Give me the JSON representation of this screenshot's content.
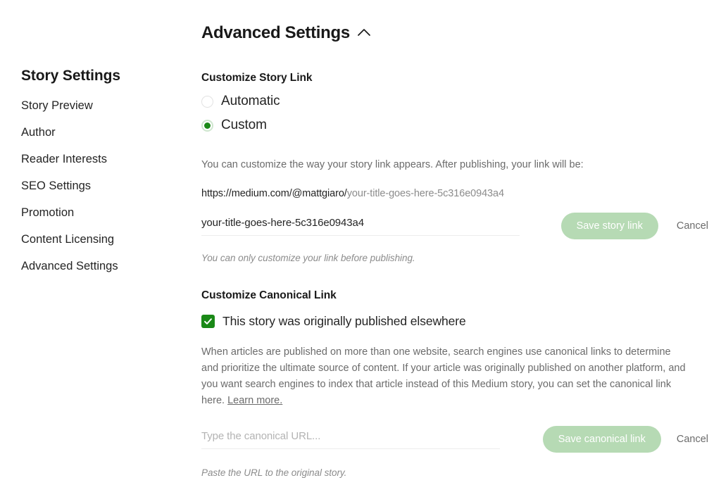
{
  "sidebar": {
    "title": "Story Settings",
    "items": [
      {
        "label": "Story Preview"
      },
      {
        "label": "Author"
      },
      {
        "label": "Reader Interests"
      },
      {
        "label": "SEO Settings"
      },
      {
        "label": "Promotion"
      },
      {
        "label": "Content Licensing"
      },
      {
        "label": "Advanced Settings"
      }
    ]
  },
  "panel": {
    "title": "Advanced Settings",
    "collapse_icon": "chevron-up-icon"
  },
  "story_link": {
    "section_title": "Customize Story Link",
    "options": [
      {
        "label": "Automatic",
        "selected": false
      },
      {
        "label": "Custom",
        "selected": true
      }
    ],
    "helper": "You can customize the way your story link appears. After publishing, your link will be:",
    "url_prefix": "https://medium.com/@mattgiaro/",
    "url_slug": "your-title-goes-here-5c316e0943a4",
    "input_value": "your-title-goes-here-5c316e0943a4",
    "input_placeholder": "",
    "save_label": "Save story link",
    "cancel_label": "Cancel",
    "hint": "You can only customize your link before publishing."
  },
  "canonical_link": {
    "section_title": "Customize Canonical Link",
    "checkbox_label": "This story was originally published elsewhere",
    "checkbox_checked": true,
    "check_icon": "check-icon",
    "paragraph": "When articles are published on more than one website, search engines use canonical links to determine and prioritize the ultimate source of content. If your article was originally published on another platform, and you want search engines to index that article instead of this Medium story, you can set the canonical link here.",
    "learn_more_label": "Learn more.",
    "input_value": "",
    "input_placeholder": "Type the canonical URL...",
    "save_label": "Save canonical link",
    "cancel_label": "Cancel",
    "hint": "Paste the URL to the original story."
  },
  "colors": {
    "accent_green": "#1a8917",
    "disabled_green": "#b6dab4",
    "radio_ring": "#cfe6cf",
    "text_primary": "#242424",
    "text_secondary": "#6b6b6b"
  }
}
